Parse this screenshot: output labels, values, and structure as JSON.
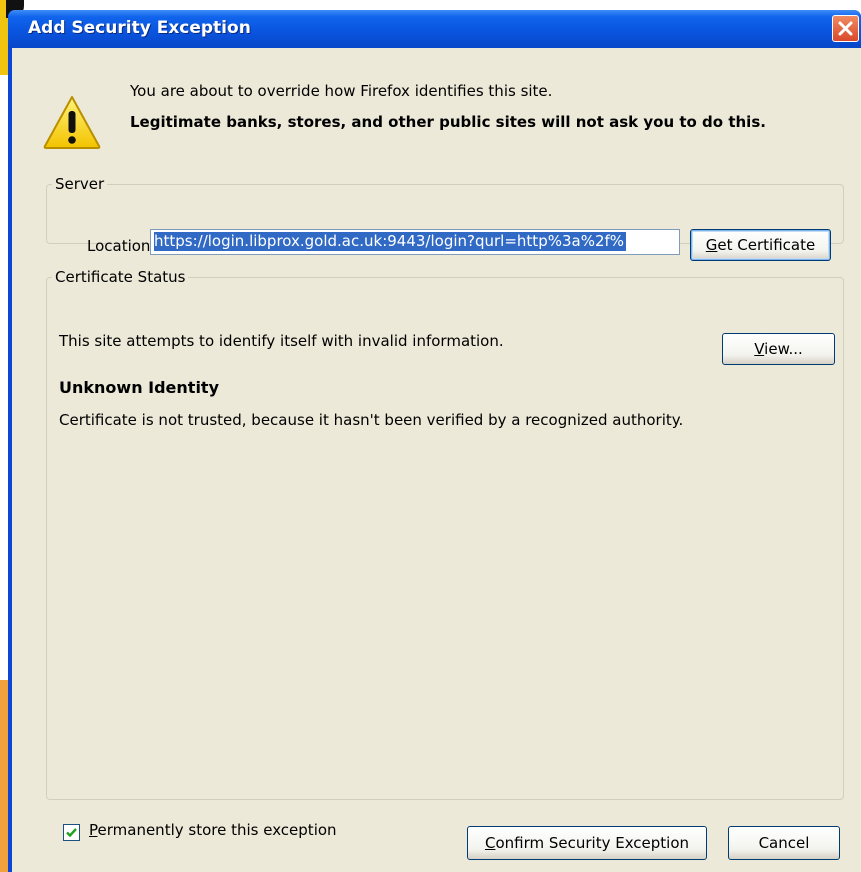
{
  "dialog": {
    "title": "Add Security Exception",
    "warning_line1": "You are about to override how Firefox identifies this site.",
    "warning_line2": "Legitimate banks, stores, and other public sites will not ask you to do this."
  },
  "server": {
    "legend": "Server",
    "location_label": "Location:",
    "location_value": "https://login.libprox.gold.ac.uk:9443/login?qurl=http%3a%2f%",
    "get_certificate": {
      "accel": "G",
      "rest": "et Certificate"
    }
  },
  "status": {
    "legend": "Certificate Status",
    "text": "This site attempts to identify itself with invalid information.",
    "view_button": {
      "accel": "V",
      "rest": "iew..."
    },
    "identity_title": "Unknown Identity",
    "identity_text": "Certificate is not trusted, because it hasn't been verified by a recognized authority."
  },
  "permanent": {
    "checked": true,
    "accel": "P",
    "rest": "ermanently store this exception"
  },
  "buttons": {
    "confirm": {
      "accel": "C",
      "rest": "onfirm Security Exception"
    },
    "cancel": "Cancel"
  },
  "colors": {
    "titlebar": "#0a55e0",
    "selection": "#316ac5",
    "dialog_bg": "#ece9d8"
  }
}
